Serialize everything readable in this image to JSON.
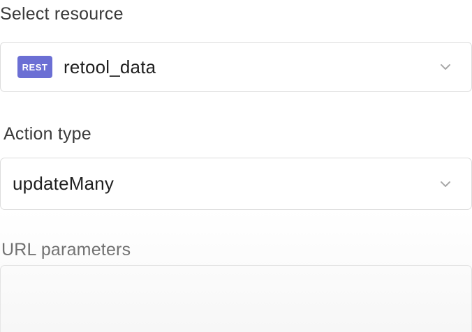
{
  "resource": {
    "label": "Select resource",
    "badge_text": "REST",
    "badge_color": "#6b6fd4",
    "value": "retool_data",
    "chevron_icon": "chevron-down-icon"
  },
  "action": {
    "label": "Action type",
    "value": "updateMany",
    "chevron_icon": "chevron-down-icon"
  },
  "url_params": {
    "label": "URL parameters",
    "value": ""
  }
}
